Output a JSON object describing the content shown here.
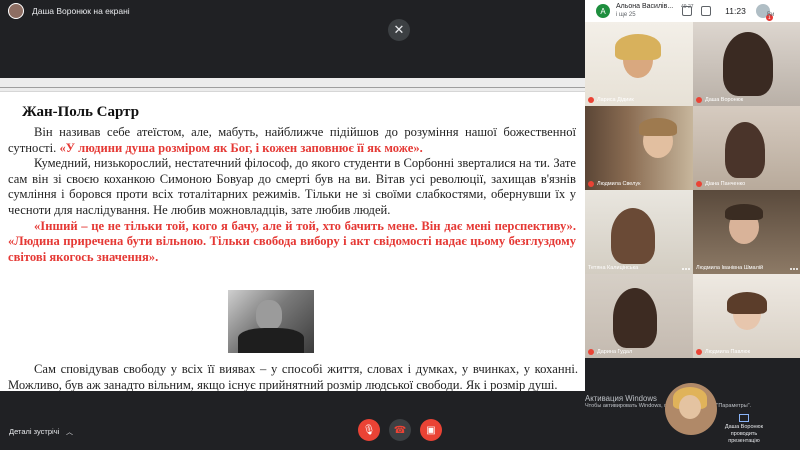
{
  "topbar": {
    "presenting_text": "Даша Воронюк на екрані"
  },
  "slide": {
    "title": "Жан-Поль Сартр",
    "p1_normal": "Він називав себе атеїстом, але, мабуть, найближче підійшов до розуміння нашої божественної сутності. ",
    "p1_red": "«У людини душа розміром як Бог, і кожен заповнює її як може».",
    "p2": "Кумедний, низькорослий, нестатечний філософ, до якого студенти в Сорбонні зверталися на ти. Зате сам він зі своєю коханкою Симоною Бовуар до смерті був на ви. Вітав усі революції, захищав в'язнів сумління і боровся проти всіх тоталітарних режимів. Тільки не зі своїми слабкостями, обернувши їх у чесноти для наслідування. Не любив можновладців, зате любив людей.",
    "p3_red": "«Інший – це не тільки той, кого я бачу, але й той, хто бачить мене. Він дає мені перспективу». «Людина приречена бути вільною. Тільки свобода вибору і акт свідомості надає цьому безглуздому світові якогось значення».",
    "p4": "Сам сповідував свободу у всіх її виявах – у способі життя, словах і думках, у вчинках, у коханні. Можливо, був аж занадто вільним, якщо існує прийнятний розмір людської свободи. Як і розмір душі."
  },
  "right_header": {
    "participant_initial": "А",
    "participant_name": "Альона Василів...",
    "participant_sub": "і ще 25",
    "time": "11:23",
    "hands": "49 27",
    "avatar_badge": "1",
    "caption": "Ви"
  },
  "tiles": [
    {
      "name": "Лариса Дідиик",
      "muted": true
    },
    {
      "name": "Даша Воронюк",
      "muted": true
    },
    {
      "name": "Людмила Свелук",
      "muted": true
    },
    {
      "name": "Діана Панченко",
      "muted": true
    },
    {
      "name": "Тетяна Калицінська",
      "muted": false
    },
    {
      "name": "Людмила Іванівна Шмалій",
      "muted": false
    },
    {
      "name": "Дарина Гудал",
      "muted": true
    },
    {
      "name": "Людмила Павлюк",
      "muted": true
    }
  ],
  "watermark": {
    "title": "Активация Windows",
    "text": "Чтобы активировать Windows, перейдите в раздел \"Параметры\"."
  },
  "presenter": {
    "label": "Даша Воронюк проводить презентацію"
  },
  "bottom": {
    "details": "Деталі зустрічі"
  },
  "colors": {
    "accent_red": "#ea4335",
    "slide_red": "#e53935",
    "bg": "#202124"
  }
}
